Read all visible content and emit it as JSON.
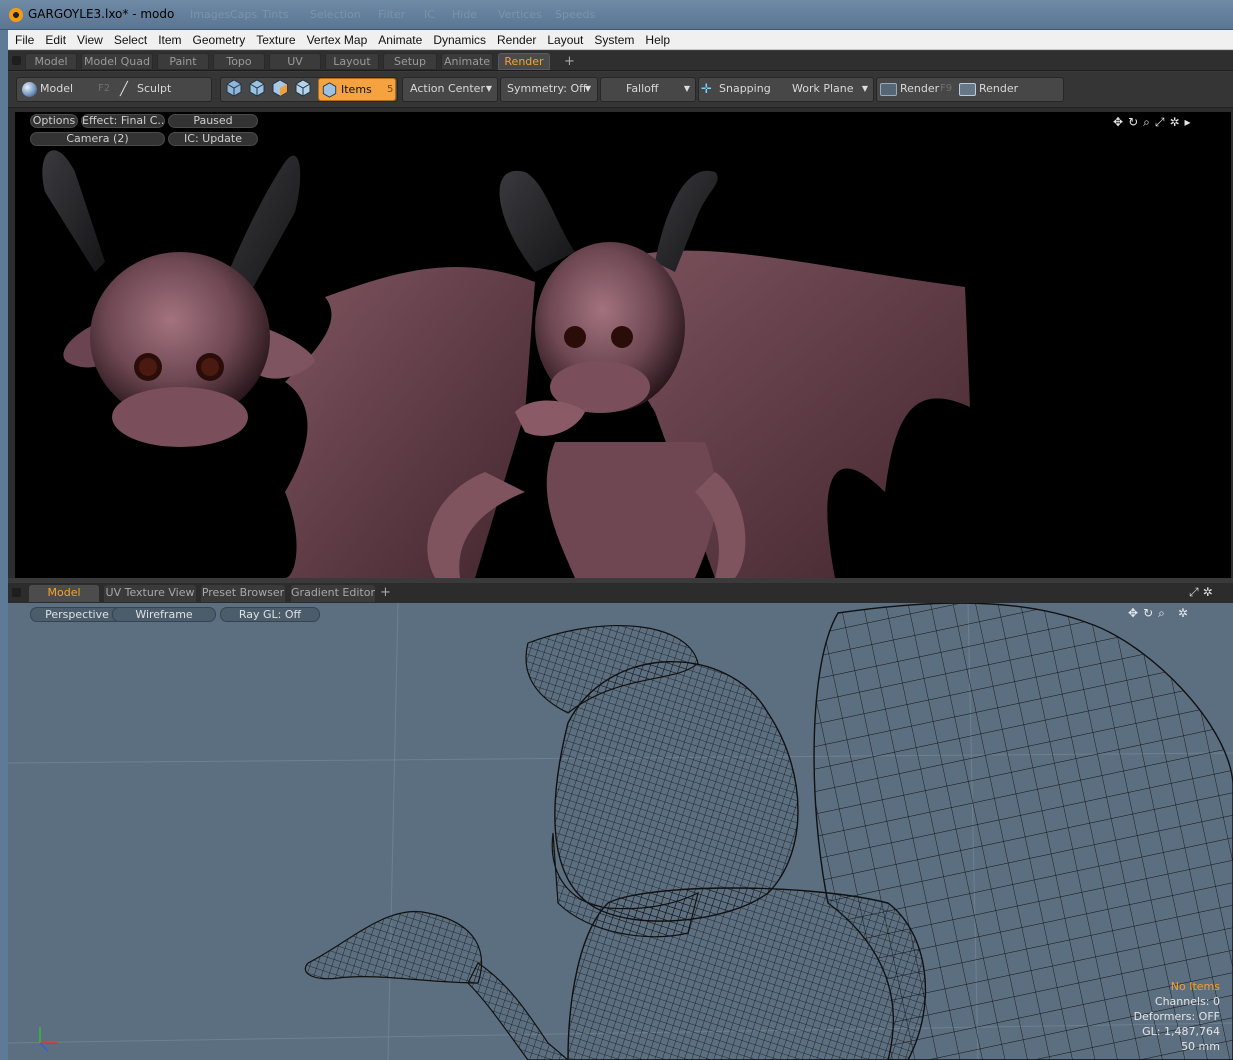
{
  "window": {
    "title": "GARGOYLE3.lxo* - modo",
    "ghost_labels": [
      "Images",
      "Caps",
      "Tints",
      "Selection",
      "Filter",
      "IC",
      "Hide",
      "Vertices",
      "Speeds"
    ]
  },
  "menu": [
    "File",
    "Edit",
    "View",
    "Select",
    "Item",
    "Geometry",
    "Texture",
    "Vertex Map",
    "Animate",
    "Dynamics",
    "Render",
    "Layout",
    "System",
    "Help"
  ],
  "layout_tabs": {
    "items": [
      "Model",
      "Model Quad",
      "Paint",
      "Topo",
      "UV",
      "Layout",
      "Setup",
      "Animate",
      "Render"
    ],
    "active": "Render",
    "add": "+"
  },
  "toolbar": {
    "model_label": "Model",
    "model_key": "F2",
    "sculpt_label": "Sculpt",
    "items_label": "Items",
    "items_key": "5",
    "action_center": "Action Center",
    "symmetry": "Symmetry: Off",
    "falloff": "Falloff",
    "snapping": "Snapping",
    "work_plane": "Work Plane",
    "render_label": "Render",
    "render_key": "F9",
    "render_window": "Render Window"
  },
  "render_view": {
    "options": "Options",
    "effect": "Effect: Final C...",
    "paused": "Paused",
    "camera": "Camera (2)",
    "ic_update": "IC: Update",
    "nav_icons": [
      "move-icon",
      "rotate-icon",
      "zoom-icon",
      "maximize-icon",
      "gear-icon",
      "play-icon"
    ]
  },
  "viewport_tabs": {
    "items": [
      "Model Single",
      "UV Texture View",
      "Preset Browser",
      "Gradient Editor"
    ],
    "active": "Model Single",
    "add": "+"
  },
  "gl_view": {
    "perspective": "Perspective",
    "wireframe": "Wireframe",
    "raygl": "Ray GL: Off",
    "info": {
      "no_items": "No Items",
      "channels": "Channels: 0",
      "deformers": "Deformers: OFF",
      "gl": "GL: 1,487,764",
      "lens": "50 mm"
    }
  },
  "colors": {
    "accent": "#f4a340",
    "viewport_bg": "#5c6f80",
    "render_bg": "#000000"
  }
}
